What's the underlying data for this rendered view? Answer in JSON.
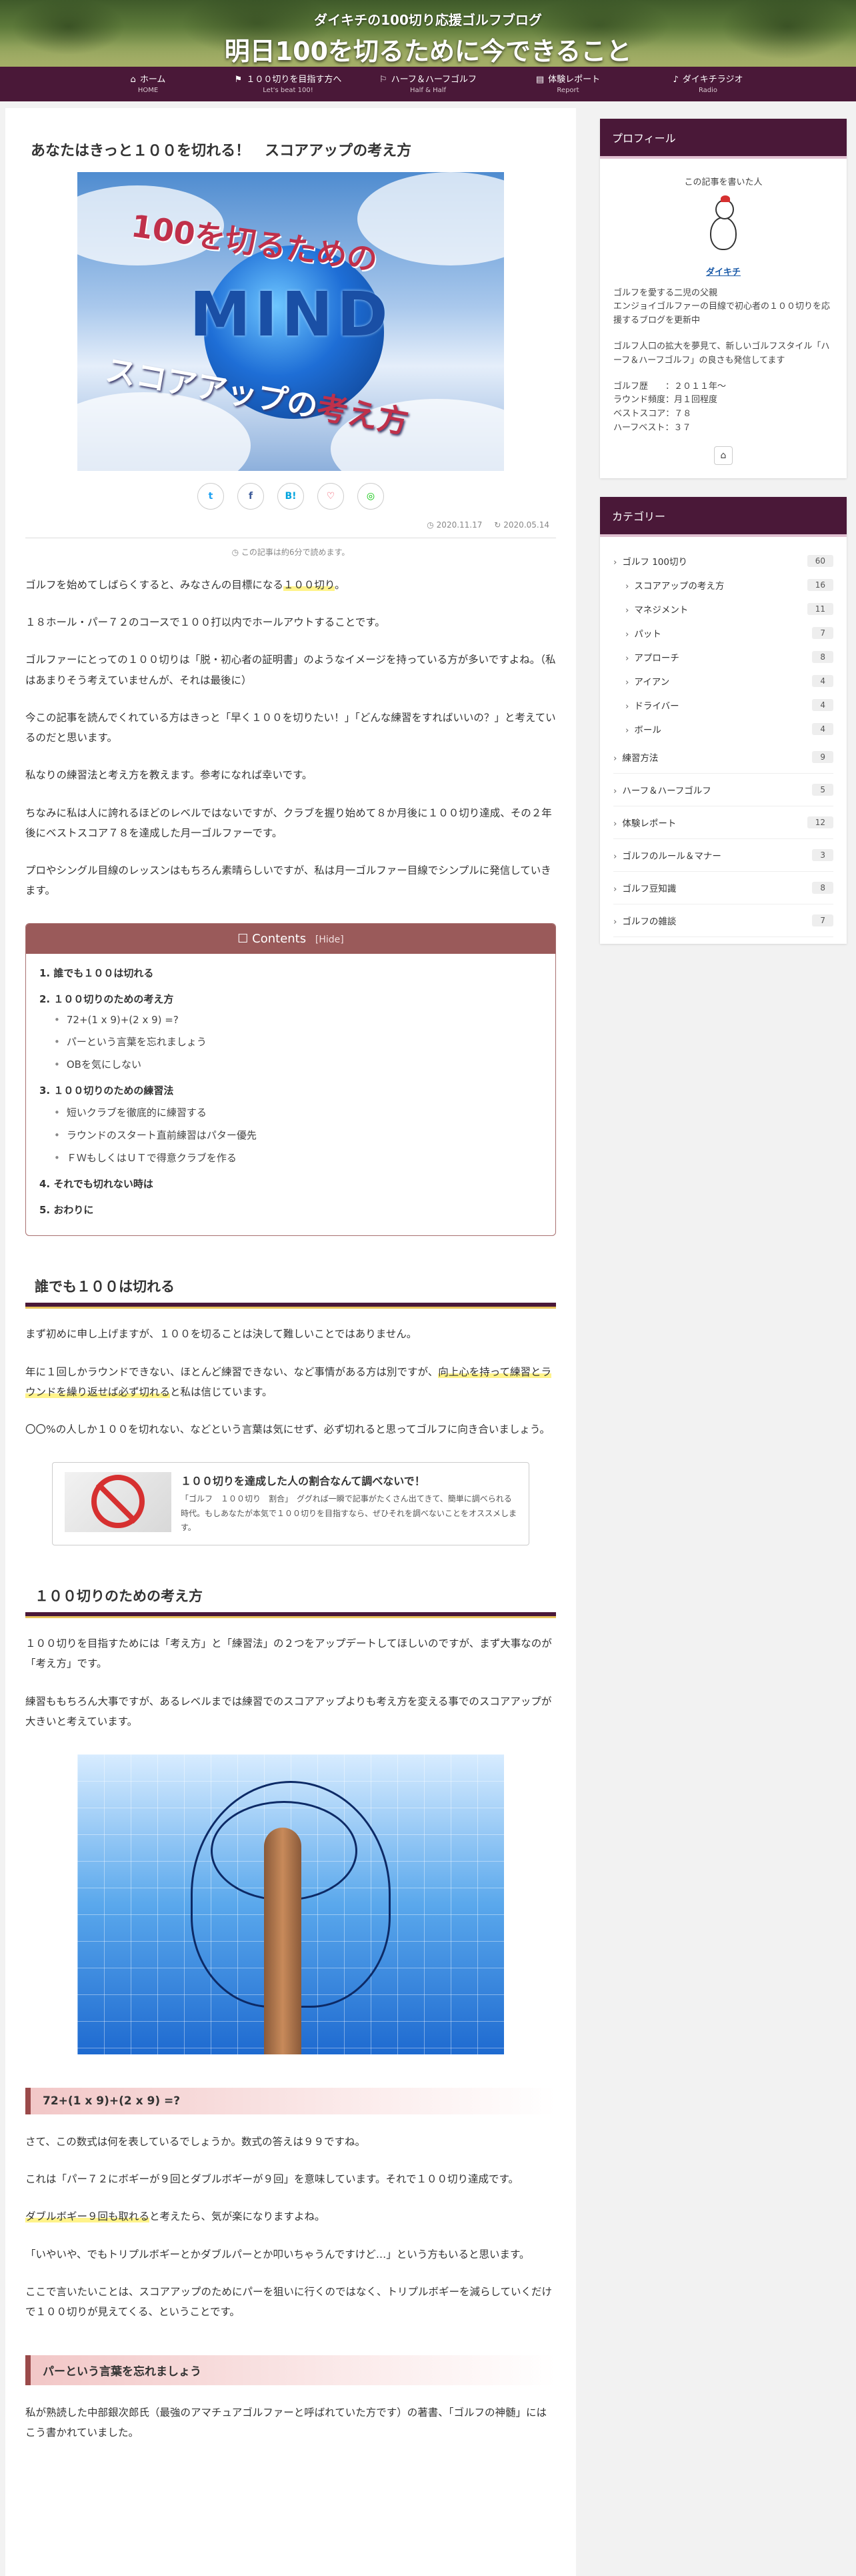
{
  "header": {
    "subtitle": "ダイキチの100切り応援ゴルフブログ",
    "title": "明日100を切るために今できること"
  },
  "nav": [
    {
      "label": "ホーム",
      "sub": "HOME",
      "icon": "home-icon"
    },
    {
      "label": "１００切りを目指す方へ",
      "sub": "Let's beat 100!",
      "icon": "flag-icon"
    },
    {
      "label": "ハーフ＆ハーフゴルフ",
      "sub": "Half & Half",
      "icon": "golf-icon"
    },
    {
      "label": "体験レポート",
      "sub": "Report",
      "icon": "report-icon"
    },
    {
      "label": "ダイキチラジオ",
      "sub": "Radio",
      "icon": "radio-icon"
    }
  ],
  "article": {
    "title": "あなたはきっと１００を切れる！　スコアアップの考え方",
    "eyecatch": {
      "top": "100を切るための",
      "mid": "MIND",
      "bot1": "スコアアップの",
      "bot2": "考え方"
    },
    "share": [
      "t",
      "f",
      "B!",
      "♡",
      "◎"
    ],
    "published": "2020.11.17",
    "updated": "2020.05.14",
    "read_time": "この記事は約6分で読めます。",
    "intro": [
      {
        "pre": "ゴルフを始めてしばらくすると、みなさんの目標になる",
        "mark": "１００切り",
        "post": "。"
      },
      {
        "pre": "１８ホール・パー７２のコースで１００打以内でホールアウトすることです。"
      },
      {
        "pre": "ゴルファーにとっての１００切りは「脱・初心者の証明書」のようなイメージを持っている方が多いですよね。（私はあまりそう考えていませんが、それは最後に）"
      },
      {
        "pre": "今この記事を読んでくれている方はきっと「早く１００を切りたい！」「どんな練習をすればいいの？」と考えているのだと思います。"
      },
      {
        "pre": "私なりの練習法と考え方を教えます。参考になれば幸いです。"
      },
      {
        "pre": "ちなみに私は人に誇れるほどのレベルではないですが、クラブを握り始めて８か月後に１００切り達成、その２年後にベストスコア７８を達成した月一ゴルファーです。"
      },
      {
        "pre": "プロやシングル目線のレッスンはもちろん素晴らしいですが、私は月一ゴルファー目線でシンプルに発信していきます。"
      }
    ],
    "toc": {
      "title": "Contents",
      "hide": "[Hide]",
      "items": [
        {
          "n": "1.",
          "label": "誰でも１００は切れる",
          "children": []
        },
        {
          "n": "2.",
          "label": "１００切りのための考え方",
          "children": [
            "72+(1 x 9)+(2 x 9) =?",
            "パーという言葉を忘れましょう",
            "OBを気にしない"
          ]
        },
        {
          "n": "3.",
          "label": "１００切りのための練習法",
          "children": [
            "短いクラブを徹底的に練習する",
            "ラウンドのスタート直前練習はパター優先",
            "ＦＷもしくはＵＴで得意クラブを作る"
          ]
        },
        {
          "n": "4.",
          "label": "それでも切れない時は",
          "children": []
        },
        {
          "n": "5.",
          "label": "おわりに",
          "children": []
        }
      ]
    },
    "s1": {
      "heading": "誰でも１００は切れる",
      "p1": "まず初めに申し上げますが、１００を切ることは決して難しいことではありません。",
      "p2_pre": "年に１回しかラウンドできない、ほとんど練習できない、など事情がある方は別ですが、",
      "p2_mark": "向上心を持って練習とラウンドを繰り返せば必ず切れる",
      "p2_post": "と私は信じています。",
      "p3": "〇〇%の人しか１００を切れない、などという言葉は気にせず、必ず切れると思ってゴルフに向き合いましょう。",
      "card_title": "１００切りを達成した人の割合なんて調べないで！",
      "card_snippet": "「ゴルフ　１００切り　割合」　ググれば一瞬で記事がたくさん出てきて、簡単に調べられる時代。もしあなたが本気で１００切りを目指すなら、ぜひそれを調べないことをオススメします。"
    },
    "s2": {
      "heading": "１００切りのための考え方",
      "p1": "１００切りを目指すためには「考え方」と「練習法」の２つをアップデートしてほしいのですが、まず大事なのが「考え方」です。",
      "p2": "練習ももちろん大事ですが、あるレベルまでは練習でのスコアアップよりも考え方を変える事でのスコアアップが大きいと考えています。"
    },
    "s21": {
      "heading": "72+(1 x 9)+(2 x 9) =?",
      "p1": "さて、この数式は何を表しているでしょうか。数式の答えは９９ですね。",
      "p2": "これは「パー７２にボギーが９回とダブルボギーが９回」を意味しています。それで１００切り達成です。",
      "p3_mark": "ダブルボギー９回も取れる",
      "p3_post": "と考えたら、気が楽になりますよね。",
      "p4": "「いやいや、でもトリプルボギーとかダブルパーとか叩いちゃうんですけど…」という方もいると思います。",
      "p5": "ここで言いたいことは、スコアアップのためにパーを狙いに行くのではなく、トリプルボギーを減らしていくだけで１００切りが見えてくる、ということです。"
    },
    "s22": {
      "heading": "パーという言葉を忘れましょう",
      "p1": "私が熟読した中部銀次郎氏（最強のアマチュアゴルファーと呼ばれていた方です）の著書、「ゴルフの神髄」にはこう書かれていました。"
    }
  },
  "sidebar": {
    "profile": {
      "heading": "プロフィール",
      "by": "この記事を書いた人",
      "name": "ダイキチ",
      "bio1": "ゴルフを愛する二児の父親",
      "bio2": "エンジョイゴルファーの目線で初心者の１００切りを応援するブログを更新中",
      "bio3": "ゴルフ人口の拡大を夢見て、新しいゴルフスタイル「ハーフ＆ハーフゴルフ」の良さも発信してます",
      "hist": "ゴルフ歴　　：２０１１年〜",
      "freq": "ラウンド頻度：月１回程度",
      "best": "ベストスコア：７８",
      "half": "ハーフベスト：３７"
    },
    "categories": {
      "heading": "カテゴリー",
      "items": [
        {
          "label": "ゴルフ 100切り",
          "count": "60",
          "sub": false,
          "top": false
        },
        {
          "label": "スコアアップの考え方",
          "count": "16",
          "sub": true,
          "top": false
        },
        {
          "label": "マネジメント",
          "count": "11",
          "sub": true,
          "top": false
        },
        {
          "label": "パット",
          "count": "7",
          "sub": true,
          "top": false
        },
        {
          "label": "アプローチ",
          "count": "8",
          "sub": true,
          "top": false
        },
        {
          "label": "アイアン",
          "count": "4",
          "sub": true,
          "top": false
        },
        {
          "label": "ドライバー",
          "count": "4",
          "sub": true,
          "top": false
        },
        {
          "label": "ボール",
          "count": "4",
          "sub": true,
          "top": false
        },
        {
          "label": "練習方法",
          "count": "9",
          "sub": true,
          "top": true
        },
        {
          "label": "ハーフ＆ハーフゴルフ",
          "count": "5",
          "sub": false,
          "top": true
        },
        {
          "label": "体験レポート",
          "count": "12",
          "sub": false,
          "top": true
        },
        {
          "label": "ゴルフのルール＆マナー",
          "count": "3",
          "sub": false,
          "top": true
        },
        {
          "label": "ゴルフ豆知識",
          "count": "8",
          "sub": false,
          "top": true
        },
        {
          "label": "ゴルフの雑談",
          "count": "7",
          "sub": false,
          "top": true
        }
      ]
    }
  }
}
